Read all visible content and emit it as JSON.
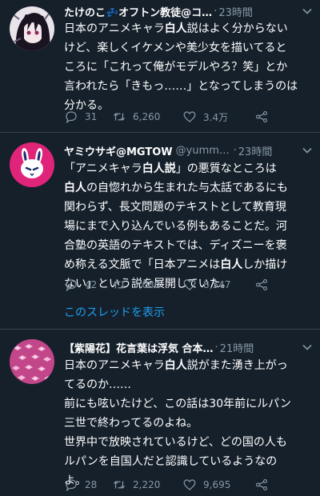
{
  "colors": {
    "background": "#15202b",
    "text": "#ffffff",
    "secondary": "#8899a6",
    "link": "#1da1f2",
    "separator": "#38444d"
  },
  "tweets": [
    {
      "name": "たけのこ💤オフトン教徒@コ…",
      "handle": "",
      "dot": "·",
      "time": "23時間",
      "avatar_icon": "dark-haired-anime-avatar",
      "lines": [
        {
          "a": "日本のアニメキャラ",
          "b": "白人",
          "c": "説はよく分からない"
        },
        {
          "a": "けど、楽しくイケメンや美少女を描いてると",
          "b": "",
          "c": ""
        },
        {
          "a": "ころに「これって俺がモデルやろ？笑」とか",
          "b": "",
          "c": ""
        },
        {
          "a": "言われたら「きもっ……」となってしまうのは",
          "b": "",
          "c": ""
        },
        {
          "a": "分かる。",
          "b": "",
          "c": ""
        }
      ],
      "stats": {
        "replies": "31",
        "retweets": "6,260",
        "likes": "3.4万"
      }
    },
    {
      "name": "ヤミウサギ@MGTOW",
      "handle": "@yummy…",
      "dot": "·",
      "time": "23時間",
      "avatar_icon": "rabbit-avatar",
      "lines": [
        {
          "a": "「アニメキャラ",
          "b": "白人説",
          "c": "」の悪質なところは"
        },
        {
          "a": "",
          "b": "白人",
          "c": "の自惚れから生まれた与太話であるにも"
        },
        {
          "a": "関わらず、長文問題のテキストとして教育現",
          "b": "",
          "c": ""
        },
        {
          "a": "場にまで入り込んでいる例もあることだ。河",
          "b": "",
          "c": ""
        },
        {
          "a": "合塾の英語のテキストでは、ディズニーを褒",
          "b": "",
          "c": ""
        },
        {
          "a": "め称える文脈で「日本アニメは",
          "b": "白人",
          "c": "しか描け"
        },
        {
          "a": "ない」という説を展開していた。",
          "b": "",
          "c": ""
        }
      ],
      "stats": {
        "replies": "42",
        "retweets": "3,080",
        "likes": "8,547"
      },
      "thread_link": "このスレッドを表示"
    },
    {
      "name": "【紫陽花】花言葉は浮気 合本…",
      "handle": "",
      "dot": "·",
      "time": "21時間",
      "avatar_icon": "hydrangea-flower-avatar",
      "lines": [
        {
          "a": "日本のアニメキャラ",
          "b": "白人",
          "c": "説がまた湧き上がっ"
        },
        {
          "a": "てるのか……",
          "b": "",
          "c": ""
        },
        {
          "a": "前にも呟いたけど、この話は30年前にルパン",
          "b": "",
          "c": ""
        },
        {
          "a": "三世で終わってるのよね。",
          "b": "",
          "c": ""
        },
        {
          "a": "世界中で放映されているけど、どの国の人も",
          "b": "",
          "c": ""
        },
        {
          "a": "ルパンを自国人だと認識しているようなの",
          "b": "",
          "c": ""
        },
        {
          "a": "よ。",
          "b": "",
          "c": ""
        }
      ],
      "stats": {
        "replies": "28",
        "retweets": "2,220",
        "likes": "9,695"
      }
    }
  ]
}
